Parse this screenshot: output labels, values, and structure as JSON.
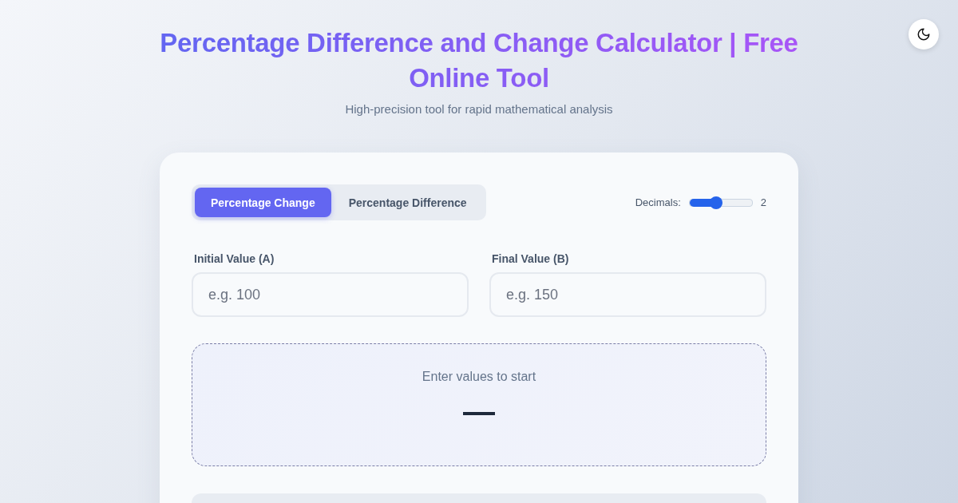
{
  "header": {
    "title": "Percentage Difference and Change Calculator | Free Online Tool",
    "subtitle": "High-precision tool for rapid mathematical analysis"
  },
  "theme_toggle": {
    "dark": false
  },
  "tabs": [
    {
      "label": "Percentage Change",
      "selected": true
    },
    {
      "label": "Percentage Difference",
      "selected": false
    }
  ],
  "decimals": {
    "label": "Decimals:",
    "level": 0.42,
    "reading": "2"
  },
  "fields": [
    {
      "label": "Initial Value (A)",
      "placeholder": "e.g. 100"
    },
    {
      "label": "Final Value (B)",
      "placeholder": "e.g. 150"
    }
  ],
  "result": {
    "message": "Enter values to start",
    "value": "—"
  }
}
